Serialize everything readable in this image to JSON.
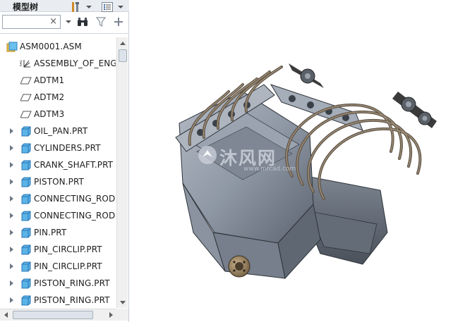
{
  "panel": {
    "title": "模型树",
    "search": {
      "value": "",
      "placeholder": ""
    }
  },
  "tree": {
    "items": [
      {
        "label": "ASM0001.ASM",
        "icon": "assembly-icon",
        "expandable": false
      },
      {
        "label": "ASSEMBLY_OF_ENG",
        "icon": "coordinate-system-icon",
        "expandable": false
      },
      {
        "label": "ADTM1",
        "icon": "datum-plane-icon",
        "expandable": false
      },
      {
        "label": "ADTM2",
        "icon": "datum-plane-icon",
        "expandable": false
      },
      {
        "label": "ADTM3",
        "icon": "datum-plane-icon",
        "expandable": false
      },
      {
        "label": "OIL_PAN.PRT",
        "icon": "part-icon",
        "expandable": true
      },
      {
        "label": "CYLINDERS.PRT",
        "icon": "part-icon",
        "expandable": true
      },
      {
        "label": "CRANK_SHAFT.PRT",
        "icon": "part-icon",
        "expandable": true
      },
      {
        "label": "PISTON.PRT",
        "icon": "part-icon",
        "expandable": true
      },
      {
        "label": "CONNECTING_ROD",
        "icon": "part-icon",
        "expandable": true
      },
      {
        "label": "CONNECTING_ROD",
        "icon": "part-icon",
        "expandable": true
      },
      {
        "label": "PIN.PRT",
        "icon": "part-icon",
        "expandable": true
      },
      {
        "label": "PIN_CIRCLIP.PRT",
        "icon": "part-icon",
        "expandable": true
      },
      {
        "label": "PIN_CIRCLIP.PRT",
        "icon": "part-icon",
        "expandable": true
      },
      {
        "label": "PISTON_RING.PRT",
        "icon": "part-icon",
        "expandable": true
      },
      {
        "label": "PISTON_RING.PRT",
        "icon": "part-icon",
        "expandable": true
      }
    ]
  },
  "watermark": {
    "text": "沐风网",
    "url": "www.mfcad.com"
  },
  "colors": {
    "accent": "#2f7fc8",
    "part_blue": "#5bb3e6",
    "engine_body": "#8e97a3",
    "header_bg": "#e9edf2"
  }
}
